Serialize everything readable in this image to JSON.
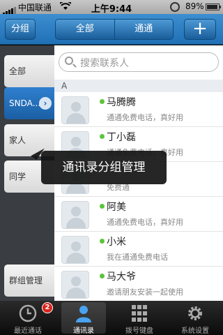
{
  "status_bar": {
    "carrier": "中国联通",
    "time": "上午9:44",
    "battery": "89%"
  },
  "nav": {
    "group_button": "分组",
    "segments": [
      "全部",
      "通通"
    ],
    "add_button": "+"
  },
  "sidebar": {
    "items": [
      {
        "label": "全部"
      },
      {
        "label": "SNDA..."
      },
      {
        "label": "家人"
      },
      {
        "label": "同学"
      },
      {
        "label": "群组管理"
      }
    ],
    "active_index": 1
  },
  "search": {
    "placeholder": "搜索联系人"
  },
  "contacts": {
    "section": "A",
    "rows": [
      {
        "name": "马腾腾",
        "sub": "通通免费电话，真好用",
        "online": true
      },
      {
        "name": "丁小磊",
        "sub": "通通免费电话，真好用",
        "online": true
      },
      {
        "name": "",
        "sub": "免费通",
        "online": false
      },
      {
        "name": "阿美",
        "sub": "通通免费电话，真好用",
        "online": true
      },
      {
        "name": "小米",
        "sub": "我在通通免费电话",
        "online": true
      },
      {
        "name": "马大爷",
        "sub": "邀请朋友安装一起使用",
        "online": false
      }
    ]
  },
  "tooltip": "通讯录分组管理",
  "tabbar": {
    "tabs": [
      {
        "label": "最近通话",
        "badge": "2"
      },
      {
        "label": "通讯录"
      },
      {
        "label": "拨号键盘"
      },
      {
        "label": "系统设置"
      }
    ],
    "active_index": 1
  },
  "colors": {
    "nav_blue": "#1f6fb4",
    "sidebar_dark": "#3a3d41",
    "online_green": "#5cc43a",
    "badge_red": "#d9251d"
  }
}
